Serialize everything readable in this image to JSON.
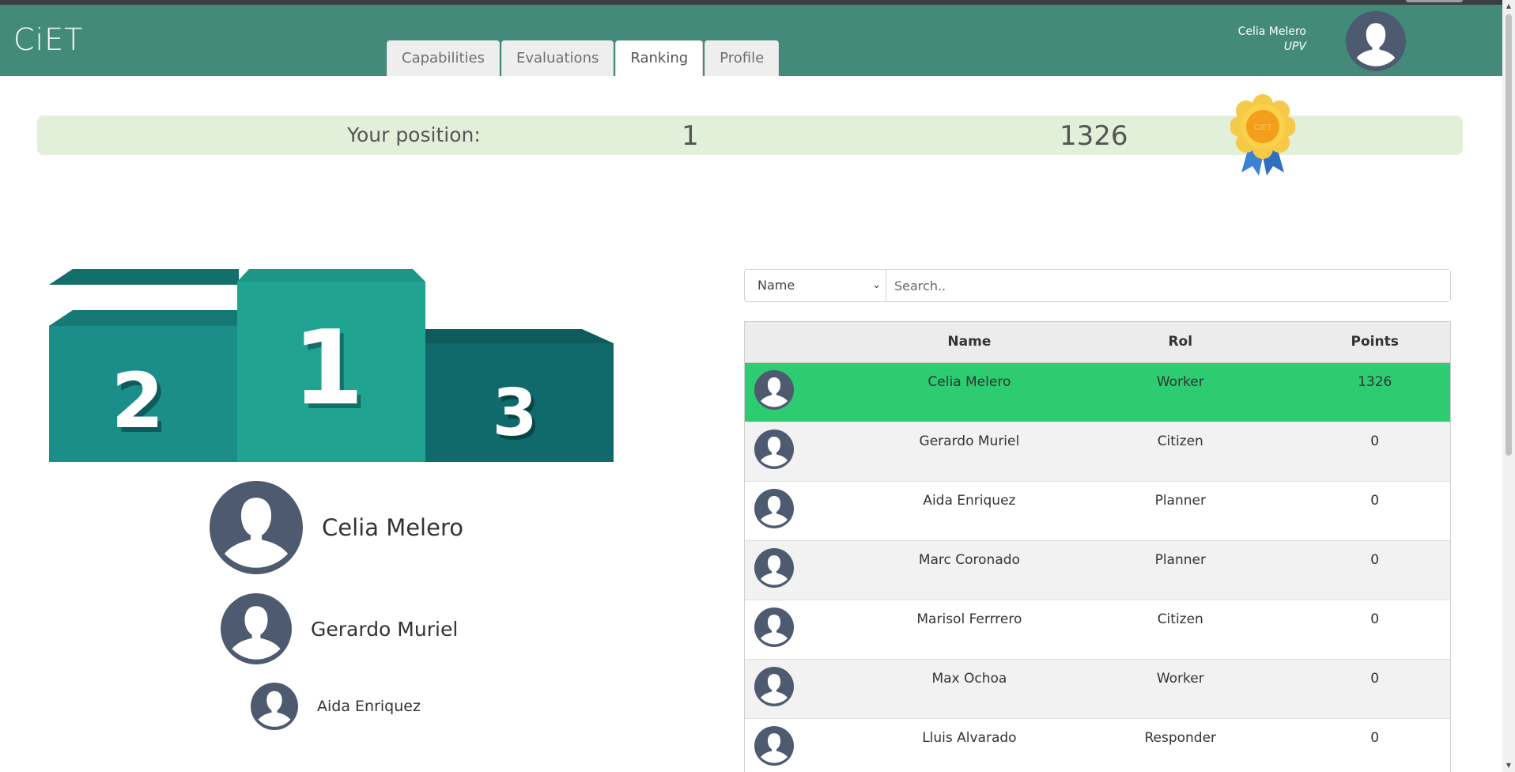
{
  "header": {
    "logo": "CiET",
    "tabs": [
      {
        "label": "Capabilities",
        "active": false
      },
      {
        "label": "Evaluations",
        "active": false
      },
      {
        "label": "Ranking",
        "active": true
      },
      {
        "label": "Profile",
        "active": false
      }
    ],
    "user": {
      "name": "Celia Melero",
      "organization": "UPV"
    }
  },
  "position": {
    "label": "Your position:",
    "rank": "1",
    "points": "1326"
  },
  "podium": {
    "labels": [
      "2",
      "1",
      "3"
    ],
    "winners": [
      {
        "place": "1",
        "name": "Celia Melero"
      },
      {
        "place": "2",
        "name": "Gerardo Muriel"
      },
      {
        "place": "3",
        "name": "Aida Enriquez"
      }
    ]
  },
  "filter": {
    "selected": "Name",
    "search_placeholder": "Search.."
  },
  "table": {
    "headers": [
      "",
      "Name",
      "Rol",
      "Points"
    ],
    "rows": [
      {
        "name": "Celia Melero",
        "rol": "Worker",
        "points": "1326",
        "highlight": true
      },
      {
        "name": "Gerardo Muriel",
        "rol": "Citizen",
        "points": "0"
      },
      {
        "name": "Aida Enriquez",
        "rol": "Planner",
        "points": "0"
      },
      {
        "name": "Marc Coronado",
        "rol": "Planner",
        "points": "0"
      },
      {
        "name": "Marisol Ferrrero",
        "rol": "Citizen",
        "points": "0"
      },
      {
        "name": "Max Ochoa",
        "rol": "Worker",
        "points": "0"
      },
      {
        "name": "Lluis Alvarado",
        "rol": "Responder",
        "points": "0"
      }
    ]
  },
  "colors": {
    "header_bg": "#438a7a",
    "position_bar_bg": "#e2efd9",
    "highlight_row": "#2ecc71",
    "avatar": "#4d5a70",
    "podium_first": "#21a391",
    "podium_second": "#1b8e89",
    "podium_third": "#10696b"
  },
  "icons": {
    "avatar": "user-avatar-icon",
    "medal": "award-medal-icon",
    "select_arrow": "chevron-down-icon"
  }
}
